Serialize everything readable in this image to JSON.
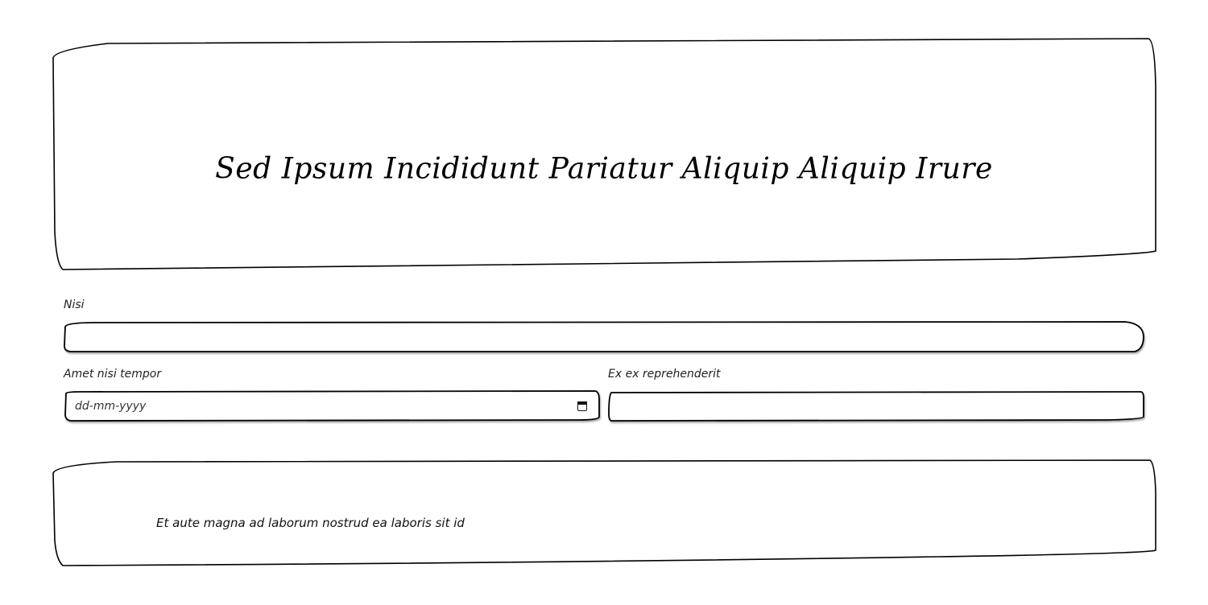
{
  "header": {
    "title": "Sed Ipsum Incididunt Pariatur Aliquip Aliquip Irure"
  },
  "form": {
    "nisi": {
      "label": "Nisi",
      "value": ""
    },
    "amet_nisi_tempor": {
      "label": "Amet nisi tempor",
      "placeholder": "dd-mm-yyyy",
      "icon": "calendar-icon"
    },
    "ex_ex_reprehenderit": {
      "label": "Ex ex reprehenderit",
      "value": ""
    }
  },
  "footer": {
    "text": "Et aute magna ad laborum nostrud ea laboris sit id"
  },
  "colors": {
    "background": "#ffffff",
    "stroke": "#000000",
    "text": "#111111"
  }
}
